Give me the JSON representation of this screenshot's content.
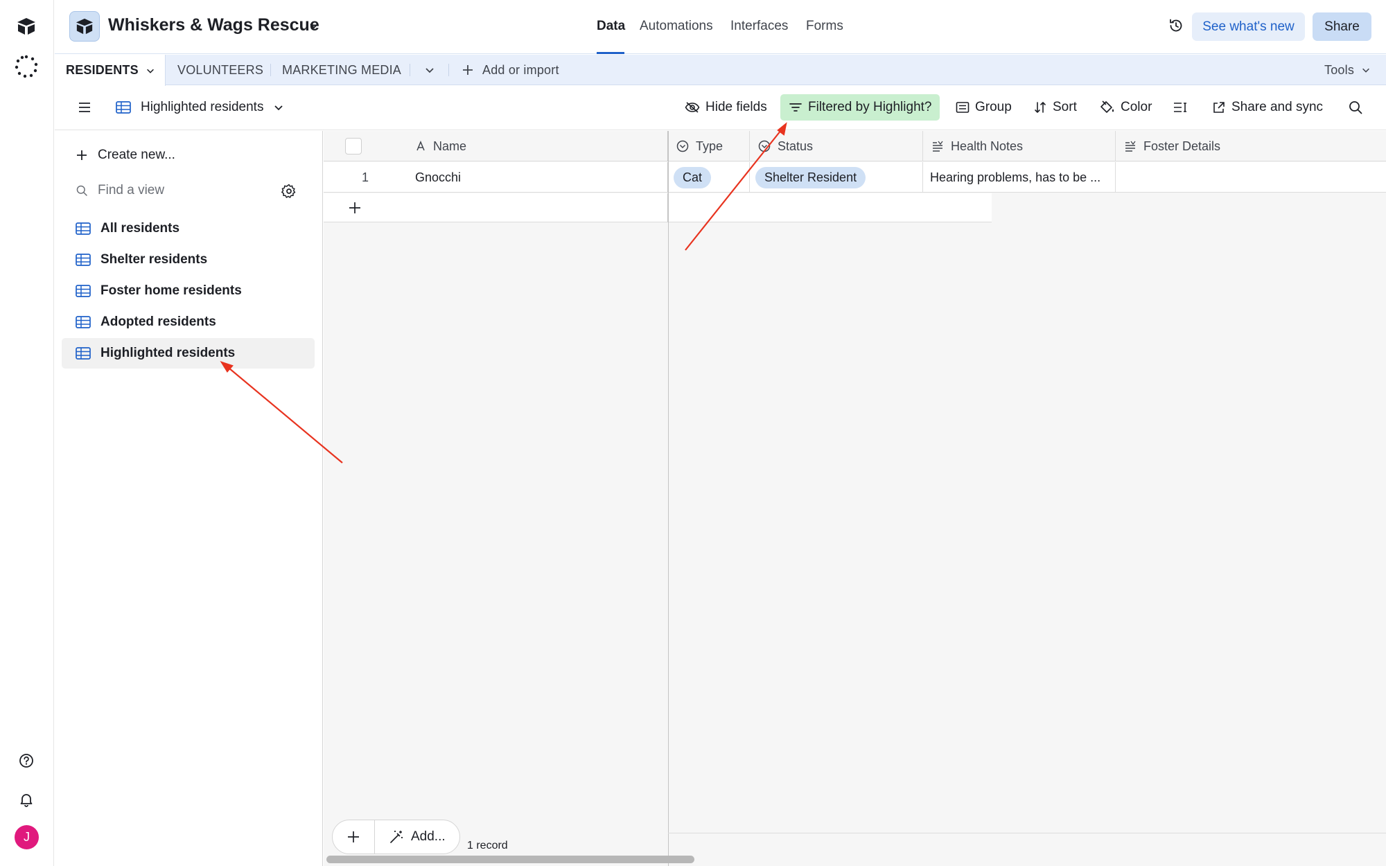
{
  "app": {
    "base_name": "Whiskers & Wags Rescue",
    "nav": [
      "Data",
      "Automations",
      "Interfaces",
      "Forms"
    ],
    "active_nav": "Data",
    "see_whats_new": "See what's new",
    "share": "Share",
    "avatar_initial": "J",
    "accent_color": "#1f61c9"
  },
  "tabs": {
    "items": [
      "RESIDENTS",
      "VOLUNTEERS",
      "MARKETING MEDIA"
    ],
    "add_or_import": "Add or import",
    "tools": "Tools"
  },
  "toolbar": {
    "view_name": "Highlighted residents",
    "hide_fields": "Hide fields",
    "filter": "Filtered by Highlight?",
    "group": "Group",
    "sort": "Sort",
    "color": "Color",
    "share_sync": "Share and sync"
  },
  "sidebar": {
    "create_new": "Create new...",
    "find_placeholder": "Find a view",
    "views": [
      "All residents",
      "Shelter residents",
      "Foster home residents",
      "Adopted residents",
      "Highlighted residents"
    ],
    "selected_view": "Highlighted residents"
  },
  "grid": {
    "columns": [
      "Name",
      "Type",
      "Status",
      "Health Notes",
      "Foster Details"
    ],
    "rows": [
      {
        "num": "1",
        "name": "Gnocchi",
        "type": "Cat",
        "status": "Shelter Resident",
        "health_notes": "Hearing problems, has to be ...",
        "foster_details": ""
      }
    ],
    "add_label": "Add...",
    "record_count": "1 record"
  },
  "annotation_color": "#e8331f"
}
